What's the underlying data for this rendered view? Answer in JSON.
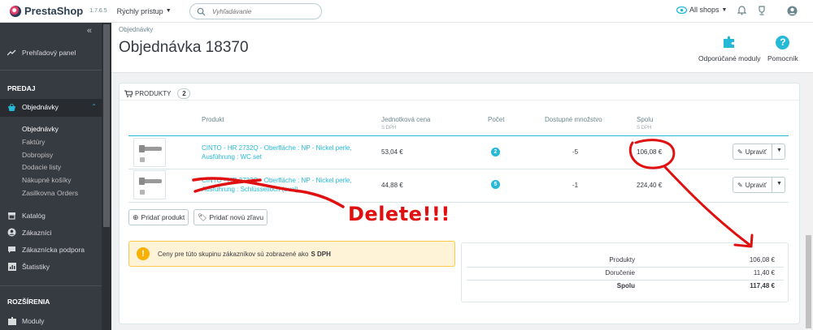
{
  "topbar": {
    "brand": "PrestaShop",
    "version": "1.7.6.5",
    "quick_access": "Rýchly prístup",
    "search_placeholder": "Vyhľadávanie",
    "shops": "All shops"
  },
  "sidebar": {
    "dashboard": "Prehľadový panel",
    "section_sell": "PREDAJ",
    "orders": "Objednávky",
    "orders_sub": [
      "Objednávky",
      "Faktúry",
      "Dobropisy",
      "Dodacie listy",
      "Nákupné košíky",
      "Zasilkovna Orders"
    ],
    "catalog": "Katalóg",
    "customers": "Zákazníci",
    "support": "Zákaznícka podpora",
    "stats": "Štatistiky",
    "section_extend": "ROZŠÍRENIA",
    "modules": "Moduly"
  },
  "header": {
    "breadcrumb": "Objednávky",
    "title": "Objednávka 18370",
    "recommended_modules": "Odporúčané moduly",
    "help": "Pomocník"
  },
  "products": {
    "title": "PRODUKTY",
    "count": "2",
    "columns": {
      "product": "Produkt",
      "unit_price": "Jednotková cena",
      "unit_price_sub": "S DPH",
      "qty": "Počet",
      "available": "Dostupné množstvo",
      "total": "Spolu",
      "total_sub": "S DPH"
    },
    "rows": [
      {
        "name": "CINTO - HR 2732Q - Oberfläche : NP - Nickel perle, Ausführung : WC set",
        "price": "53,04 €",
        "qty": "2",
        "available": "-5",
        "total": "106,08 €",
        "edit": "Upraviť"
      },
      {
        "name": "CINTO - HR 2732Q - Oberfläche : NP - Nickel perle, Ausführung : Schlüsselloch (oval)",
        "price": "44,88 €",
        "qty": "5",
        "available": "-1",
        "total": "224,40 €",
        "edit": "Upraviť"
      }
    ],
    "add_product": "Pridať produkt",
    "add_discount": "Pridať novú zľavu",
    "alert_text": "Ceny pre túto skupinu zákazníkov sú zobrazené ako",
    "alert_bold": "S DPH",
    "totals": [
      {
        "label": "Produkty",
        "value": "106,08 €"
      },
      {
        "label": "Doručenie",
        "value": "11,40 €"
      },
      {
        "label": "Spolu",
        "value": "117,48 €"
      }
    ]
  },
  "annotation": {
    "text": "Delete!!!",
    "color": "#e01010"
  },
  "colors": {
    "accent": "#25b9d7",
    "sidebar": "#363a41",
    "warning": "#fab000"
  }
}
